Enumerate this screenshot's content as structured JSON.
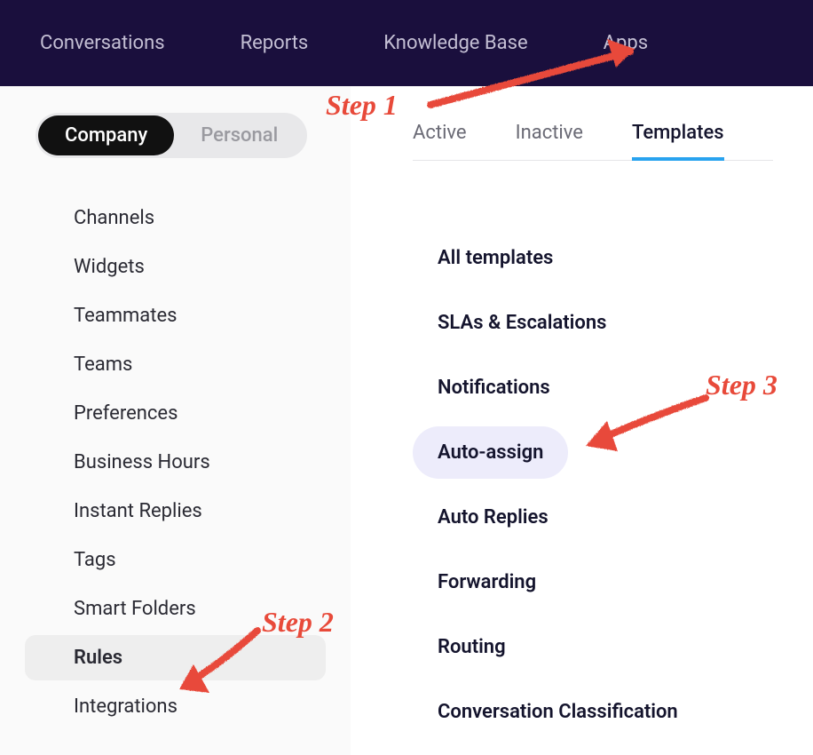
{
  "top_nav": {
    "items": [
      {
        "label": "Conversations"
      },
      {
        "label": "Reports"
      },
      {
        "label": "Knowledge Base"
      },
      {
        "label": "Apps"
      }
    ]
  },
  "sidebar": {
    "toggle": {
      "company": "Company",
      "personal": "Personal"
    },
    "items": [
      {
        "label": "Channels"
      },
      {
        "label": "Widgets"
      },
      {
        "label": "Teammates"
      },
      {
        "label": "Teams"
      },
      {
        "label": "Preferences"
      },
      {
        "label": "Business Hours"
      },
      {
        "label": "Instant Replies"
      },
      {
        "label": "Tags"
      },
      {
        "label": "Smart Folders"
      },
      {
        "label": "Rules"
      },
      {
        "label": "Integrations"
      }
    ],
    "active_index": 9
  },
  "tabs": {
    "items": [
      {
        "label": "Active"
      },
      {
        "label": "Inactive"
      },
      {
        "label": "Templates"
      }
    ],
    "active_index": 2
  },
  "templates": {
    "items": [
      {
        "label": "All templates"
      },
      {
        "label": "SLAs & Escalations"
      },
      {
        "label": "Notifications"
      },
      {
        "label": "Auto-assign"
      },
      {
        "label": "Auto Replies"
      },
      {
        "label": "Forwarding"
      },
      {
        "label": "Routing"
      },
      {
        "label": "Conversation Classification"
      }
    ],
    "active_index": 3
  },
  "annotations": {
    "step1": "Step 1",
    "step2": "Step 2",
    "step3": "Step 3",
    "color": "#e84a3a"
  }
}
